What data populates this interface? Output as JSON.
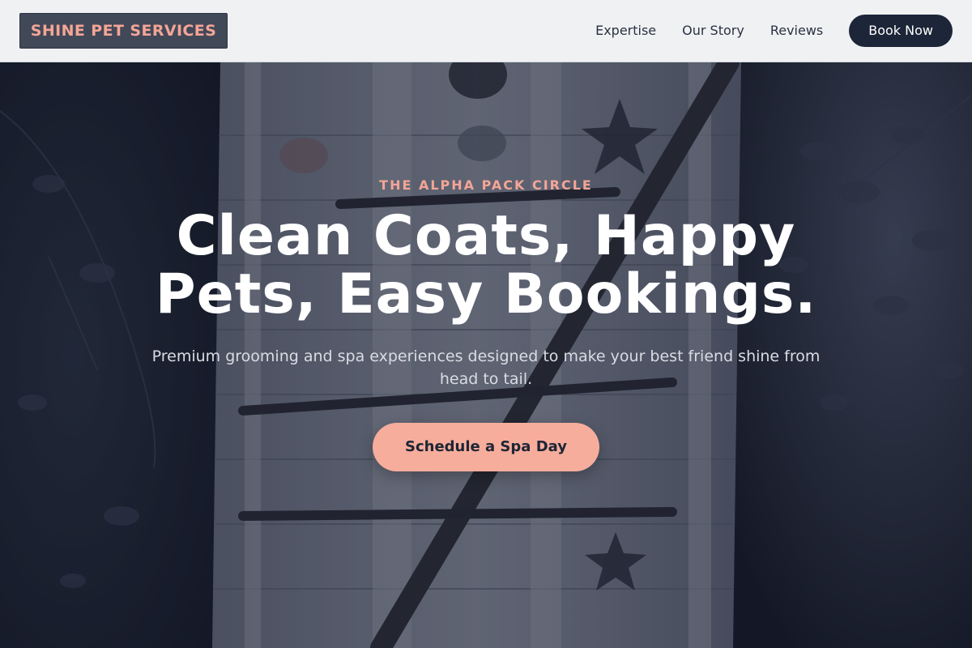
{
  "brand": {
    "name": "SHINE PET SERVICES",
    "accent_color": "#f4a596",
    "dark_color": "#1d2538"
  },
  "nav": {
    "links": [
      "Expertise",
      "Our Story",
      "Reviews"
    ],
    "cta_label": "Book Now"
  },
  "hero": {
    "eyebrow": "THE ALPHA PACK CIRCLE",
    "headline_line1": "Clean Coats, Happy",
    "headline_line2": "Pets, Easy Bookings.",
    "subtitle": "Premium grooming and spa experiences designed to make your best friend shine from head to tail.",
    "cta_label": "Schedule a Spa Day"
  }
}
